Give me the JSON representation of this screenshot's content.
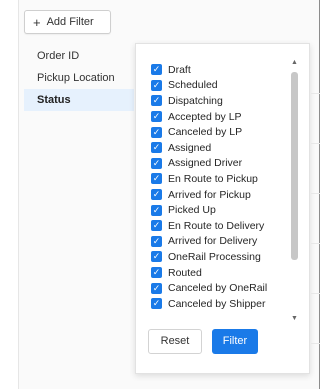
{
  "toolbar": {
    "add_filter_label": "Add Filter",
    "add_filter_icon": "plus-icon"
  },
  "fields": [
    {
      "label": "Order ID",
      "active": false
    },
    {
      "label": "Pickup Location",
      "active": false
    },
    {
      "label": "Status",
      "active": true
    }
  ],
  "status_filter": {
    "options": [
      {
        "label": "Draft",
        "checked": true
      },
      {
        "label": "Scheduled",
        "checked": true
      },
      {
        "label": "Dispatching",
        "checked": true
      },
      {
        "label": "Accepted by LP",
        "checked": true
      },
      {
        "label": "Canceled by LP",
        "checked": true
      },
      {
        "label": "Assigned",
        "checked": true
      },
      {
        "label": "Assigned Driver",
        "checked": true
      },
      {
        "label": "En Route to Pickup",
        "checked": true
      },
      {
        "label": "Arrived for Pickup",
        "checked": true
      },
      {
        "label": "Picked Up",
        "checked": true
      },
      {
        "label": "En Route to Delivery",
        "checked": true
      },
      {
        "label": "Arrived for Delivery",
        "checked": true
      },
      {
        "label": "OneRail Processing",
        "checked": true
      },
      {
        "label": "Routed",
        "checked": true
      },
      {
        "label": "Canceled by OneRail",
        "checked": true
      },
      {
        "label": "Canceled by Shipper",
        "checked": true
      }
    ],
    "reset_label": "Reset",
    "filter_label": "Filter"
  },
  "colors": {
    "accent": "#1a7ae8",
    "active_row": "#e6f1fd"
  }
}
